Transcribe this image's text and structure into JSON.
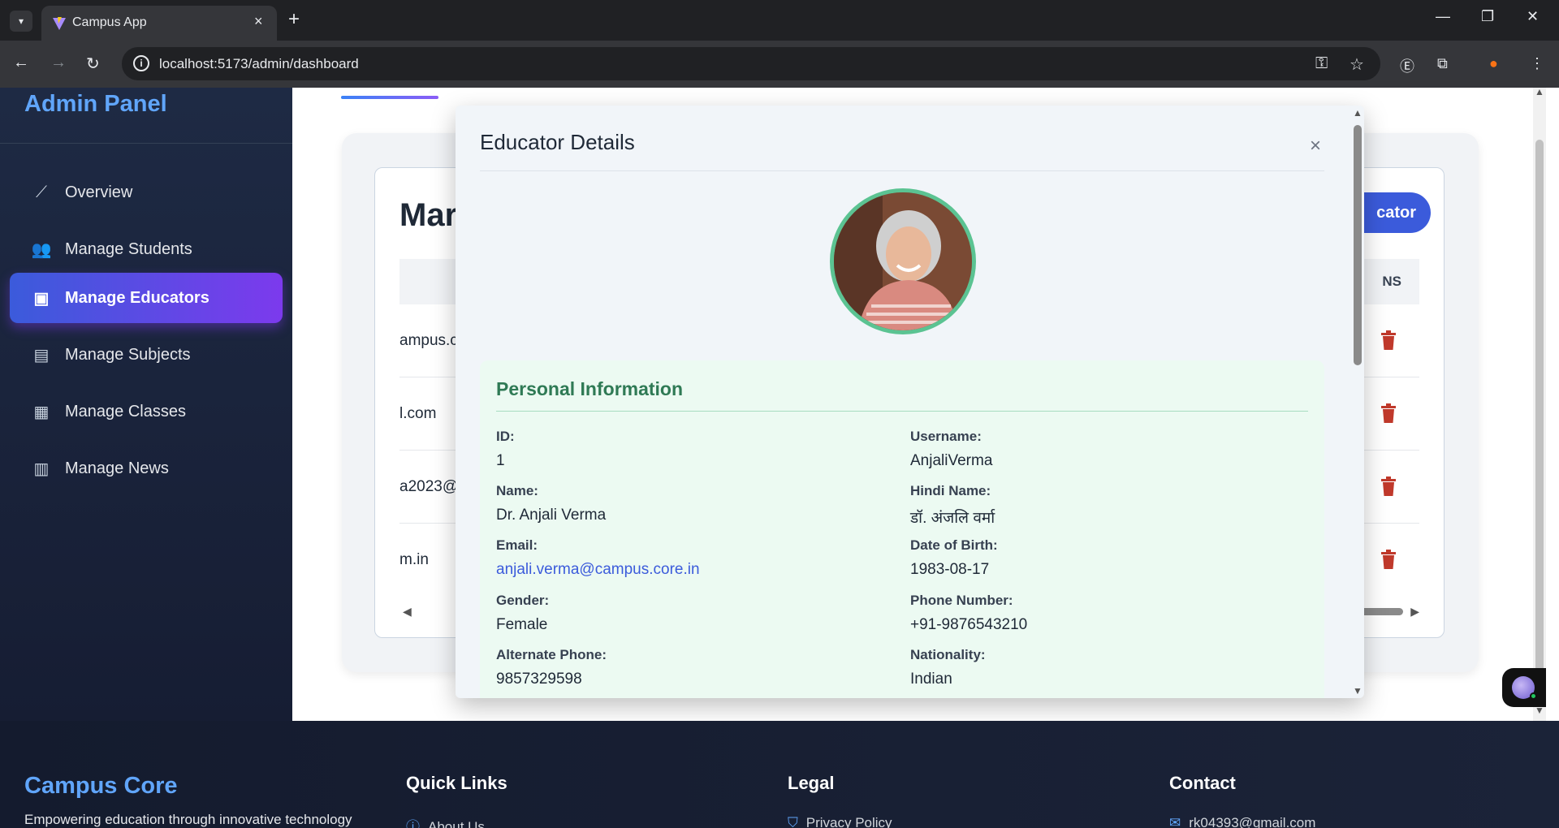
{
  "browser": {
    "tab_title": "Campus App",
    "tab_close": "×",
    "new_tab": "+",
    "url": "localhost:5173/admin/dashboard",
    "window_controls": [
      "—",
      "❐",
      "✕"
    ]
  },
  "sidebar": {
    "brand": "Admin Panel",
    "items": [
      {
        "label": "Overview",
        "icon": "chart-line-icon",
        "glyph": "📈",
        "active": false
      },
      {
        "label": "Manage Students",
        "icon": "users-icon",
        "glyph": "👥",
        "active": false
      },
      {
        "label": "Manage Educators",
        "icon": "chalkboard-teacher-icon",
        "glyph": "🧑‍🏫",
        "active": true
      },
      {
        "label": "Manage Subjects",
        "icon": "book-icon",
        "glyph": "📘",
        "active": false
      },
      {
        "label": "Manage Classes",
        "icon": "building-icon",
        "glyph": "🏢",
        "active": false
      },
      {
        "label": "Manage News",
        "icon": "newspaper-icon",
        "glyph": "📰",
        "active": false
      }
    ]
  },
  "main": {
    "title_partial": "Mar",
    "add_button_partial": "cator",
    "actions_header_partial": "NS",
    "rows": [
      {
        "email_partial": "ampus.c"
      },
      {
        "email_partial": "l.com"
      },
      {
        "email_partial": "a2023@"
      },
      {
        "email_partial": "m.in"
      }
    ]
  },
  "modal": {
    "title": "Educator Details",
    "close": "×",
    "section_title": "Personal Information",
    "fields": [
      {
        "label": "ID:",
        "value": "1"
      },
      {
        "label": "Username:",
        "value": "AnjaliVerma"
      },
      {
        "label": "Name:",
        "value": "Dr. Anjali Verma"
      },
      {
        "label": "Hindi Name:",
        "value": "डॉ. अंजलि वर्मा"
      },
      {
        "label": "Email:",
        "value": "anjali.verma@campus.core.in",
        "link": true
      },
      {
        "label": "Date of Birth:",
        "value": "1983-08-17"
      },
      {
        "label": "Gender:",
        "value": "Female"
      },
      {
        "label": "Phone Number:",
        "value": "+91-9876543210"
      },
      {
        "label": "Alternate Phone:",
        "value": "9857329598"
      },
      {
        "label": "Nationality:",
        "value": "Indian"
      }
    ]
  },
  "footer": {
    "brand": "Campus Core",
    "tagline": "Empowering education through innovative technology",
    "quick_links": {
      "heading": "Quick Links",
      "first": "About Us"
    },
    "legal": {
      "heading": "Legal",
      "first": "Privacy Policy"
    },
    "contact": {
      "heading": "Contact",
      "first": "rk04393@gmail.com"
    }
  },
  "colors": {
    "accent": "#3b5bdb",
    "active_gradient_end": "#7c3aed",
    "brand_blue": "#60a5fa",
    "section_green": "#2f7a55",
    "avatar_ring": "#5bc392",
    "trash_red": "#c0392b"
  }
}
